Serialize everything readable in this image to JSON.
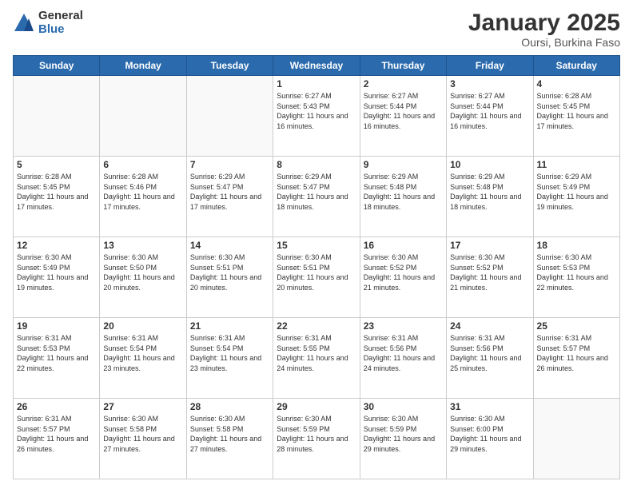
{
  "logo": {
    "general": "General",
    "blue": "Blue"
  },
  "title": "January 2025",
  "location": "Oursi, Burkina Faso",
  "days_of_week": [
    "Sunday",
    "Monday",
    "Tuesday",
    "Wednesday",
    "Thursday",
    "Friday",
    "Saturday"
  ],
  "weeks": [
    [
      {
        "day": "",
        "info": ""
      },
      {
        "day": "",
        "info": ""
      },
      {
        "day": "",
        "info": ""
      },
      {
        "day": "1",
        "info": "Sunrise: 6:27 AM\nSunset: 5:43 PM\nDaylight: 11 hours and 16 minutes."
      },
      {
        "day": "2",
        "info": "Sunrise: 6:27 AM\nSunset: 5:44 PM\nDaylight: 11 hours and 16 minutes."
      },
      {
        "day": "3",
        "info": "Sunrise: 6:27 AM\nSunset: 5:44 PM\nDaylight: 11 hours and 16 minutes."
      },
      {
        "day": "4",
        "info": "Sunrise: 6:28 AM\nSunset: 5:45 PM\nDaylight: 11 hours and 17 minutes."
      }
    ],
    [
      {
        "day": "5",
        "info": "Sunrise: 6:28 AM\nSunset: 5:45 PM\nDaylight: 11 hours and 17 minutes."
      },
      {
        "day": "6",
        "info": "Sunrise: 6:28 AM\nSunset: 5:46 PM\nDaylight: 11 hours and 17 minutes."
      },
      {
        "day": "7",
        "info": "Sunrise: 6:29 AM\nSunset: 5:47 PM\nDaylight: 11 hours and 17 minutes."
      },
      {
        "day": "8",
        "info": "Sunrise: 6:29 AM\nSunset: 5:47 PM\nDaylight: 11 hours and 18 minutes."
      },
      {
        "day": "9",
        "info": "Sunrise: 6:29 AM\nSunset: 5:48 PM\nDaylight: 11 hours and 18 minutes."
      },
      {
        "day": "10",
        "info": "Sunrise: 6:29 AM\nSunset: 5:48 PM\nDaylight: 11 hours and 18 minutes."
      },
      {
        "day": "11",
        "info": "Sunrise: 6:29 AM\nSunset: 5:49 PM\nDaylight: 11 hours and 19 minutes."
      }
    ],
    [
      {
        "day": "12",
        "info": "Sunrise: 6:30 AM\nSunset: 5:49 PM\nDaylight: 11 hours and 19 minutes."
      },
      {
        "day": "13",
        "info": "Sunrise: 6:30 AM\nSunset: 5:50 PM\nDaylight: 11 hours and 20 minutes."
      },
      {
        "day": "14",
        "info": "Sunrise: 6:30 AM\nSunset: 5:51 PM\nDaylight: 11 hours and 20 minutes."
      },
      {
        "day": "15",
        "info": "Sunrise: 6:30 AM\nSunset: 5:51 PM\nDaylight: 11 hours and 20 minutes."
      },
      {
        "day": "16",
        "info": "Sunrise: 6:30 AM\nSunset: 5:52 PM\nDaylight: 11 hours and 21 minutes."
      },
      {
        "day": "17",
        "info": "Sunrise: 6:30 AM\nSunset: 5:52 PM\nDaylight: 11 hours and 21 minutes."
      },
      {
        "day": "18",
        "info": "Sunrise: 6:30 AM\nSunset: 5:53 PM\nDaylight: 11 hours and 22 minutes."
      }
    ],
    [
      {
        "day": "19",
        "info": "Sunrise: 6:31 AM\nSunset: 5:53 PM\nDaylight: 11 hours and 22 minutes."
      },
      {
        "day": "20",
        "info": "Sunrise: 6:31 AM\nSunset: 5:54 PM\nDaylight: 11 hours and 23 minutes."
      },
      {
        "day": "21",
        "info": "Sunrise: 6:31 AM\nSunset: 5:54 PM\nDaylight: 11 hours and 23 minutes."
      },
      {
        "day": "22",
        "info": "Sunrise: 6:31 AM\nSunset: 5:55 PM\nDaylight: 11 hours and 24 minutes."
      },
      {
        "day": "23",
        "info": "Sunrise: 6:31 AM\nSunset: 5:56 PM\nDaylight: 11 hours and 24 minutes."
      },
      {
        "day": "24",
        "info": "Sunrise: 6:31 AM\nSunset: 5:56 PM\nDaylight: 11 hours and 25 minutes."
      },
      {
        "day": "25",
        "info": "Sunrise: 6:31 AM\nSunset: 5:57 PM\nDaylight: 11 hours and 26 minutes."
      }
    ],
    [
      {
        "day": "26",
        "info": "Sunrise: 6:31 AM\nSunset: 5:57 PM\nDaylight: 11 hours and 26 minutes."
      },
      {
        "day": "27",
        "info": "Sunrise: 6:30 AM\nSunset: 5:58 PM\nDaylight: 11 hours and 27 minutes."
      },
      {
        "day": "28",
        "info": "Sunrise: 6:30 AM\nSunset: 5:58 PM\nDaylight: 11 hours and 27 minutes."
      },
      {
        "day": "29",
        "info": "Sunrise: 6:30 AM\nSunset: 5:59 PM\nDaylight: 11 hours and 28 minutes."
      },
      {
        "day": "30",
        "info": "Sunrise: 6:30 AM\nSunset: 5:59 PM\nDaylight: 11 hours and 29 minutes."
      },
      {
        "day": "31",
        "info": "Sunrise: 6:30 AM\nSunset: 6:00 PM\nDaylight: 11 hours and 29 minutes."
      },
      {
        "day": "",
        "info": ""
      }
    ]
  ]
}
